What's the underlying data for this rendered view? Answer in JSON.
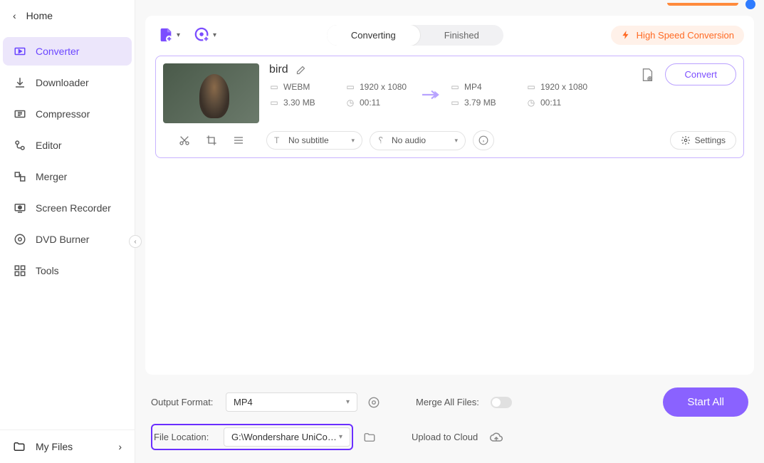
{
  "home": "Home",
  "nav": [
    {
      "label": "Converter"
    },
    {
      "label": "Downloader"
    },
    {
      "label": "Compressor"
    },
    {
      "label": "Editor"
    },
    {
      "label": "Merger"
    },
    {
      "label": "Screen Recorder"
    },
    {
      "label": "DVD Burner"
    },
    {
      "label": "Tools"
    }
  ],
  "myFiles": "My Files",
  "tabs": {
    "converting": "Converting",
    "finished": "Finished"
  },
  "hsc": "High Speed Conversion",
  "file": {
    "name": "bird",
    "src": {
      "format": "WEBM",
      "res": "1920 x 1080",
      "size": "3.30 MB",
      "dur": "00:11"
    },
    "dst": {
      "format": "MP4",
      "res": "1920 x 1080",
      "size": "3.79 MB",
      "dur": "00:11"
    },
    "convert": "Convert",
    "subtitle": "No subtitle",
    "audio": "No audio",
    "settings": "Settings"
  },
  "bottom": {
    "outputFormatLabel": "Output Format:",
    "outputFormat": "MP4",
    "fileLocationLabel": "File Location:",
    "fileLocation": "G:\\Wondershare UniConverter",
    "mergeLabel": "Merge All Files:",
    "uploadLabel": "Upload to Cloud",
    "startAll": "Start All"
  }
}
